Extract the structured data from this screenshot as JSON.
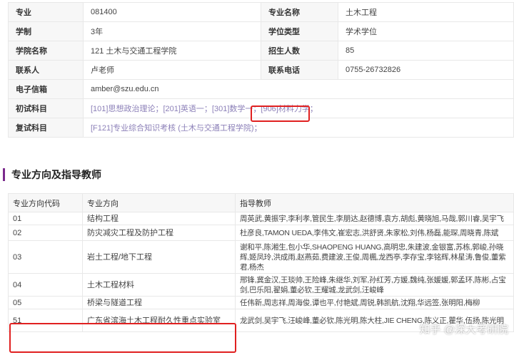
{
  "info": {
    "rows": [
      {
        "label1": "专业",
        "value1": "081400",
        "label2": "专业名称",
        "value2": "土木工程"
      },
      {
        "label1": "学制",
        "value1": "3年",
        "label2": "学位类型",
        "value2": "学术学位"
      },
      {
        "label1": "学院名称",
        "value1": "121 土木与交通工程学院",
        "label2": "招生人数",
        "value2": "85"
      },
      {
        "label1": "联系人",
        "value1": "卢老师",
        "label2": "联系电话",
        "value2": "0755-26732826"
      }
    ],
    "email": {
      "label": "电子信箱",
      "value": "amber@szu.edu.cn"
    },
    "exam": {
      "label": "初试科目",
      "value": "[101]思想政治理论；[201]英语一；[301]数学一；[906]材料力学；"
    },
    "retest": {
      "label": "复试科目",
      "value": "[F121]专业综合知识考核 (土木与交通工程学院)；"
    }
  },
  "section_title": "专业方向及指导教师",
  "directions": {
    "headers": [
      "专业方向代码",
      "专业方向",
      "指导教师"
    ],
    "rows": [
      {
        "code": "01",
        "name": "结构工程",
        "teachers": "周英武,黄振宇,李利孝,管民生,李朋达,赵德博,袁方,胡彪,黄晓旭,马哉,郭川睿,吴宇飞"
      },
      {
        "code": "02",
        "name": "防灾减灾工程及防护工程",
        "teachers": "杜彦良,TAMON UEDA,李伟文,崔宏志,洪舒贤,朱家松,刘伟,杨磊,能琛,周晓青,陈斌"
      },
      {
        "code": "03",
        "name": "岩土工程/地下工程",
        "teachers": "谢和平,陈湘生,包小华,SHAOPENG HUANG,高明忠,朱建波,金银富,苏栋,郭峻,孙晓辉,姬凤玲,洪成雨,赵燕茹,费建波,王俊,周楓,龙西亭,李存宝,李铭辉,林星涛,鲁俊,董紫君,杨杰"
      },
      {
        "code": "04",
        "name": "土木工程材料",
        "teachers": "邢锋,冀金汉,王琰帅,王险峰,朱继华,刘军,孙红芳,方媛,魏纯,张媛媛,郭孟环,陈彬,占宝剑,巴乐阳,翟娟,董必钦,王耀城,龙武剑,汪峻峰"
      },
      {
        "code": "05",
        "name": "桥梁与隧道工程",
        "teachers": "任伟新,周志祥,周海俊,谭也平,付艳斌,周锐,韩凯航,沈翔,华远签,张明阳,梅柳"
      },
      {
        "code": "51",
        "name": "广东省滨海土木工程耐久性重点实验室",
        "teachers": "龙武剑,吴宇飞,汪峻峰,董必钦,陈光明,陈大柱,JIE CHENG,陈义正,瞿华,伍扬,陈光明"
      }
    ]
  },
  "watermark": "知乎 @深大考研院",
  "colors": {
    "highlight": "#e02020",
    "accent": "#7b2a8c",
    "link": "#8c80b8"
  }
}
